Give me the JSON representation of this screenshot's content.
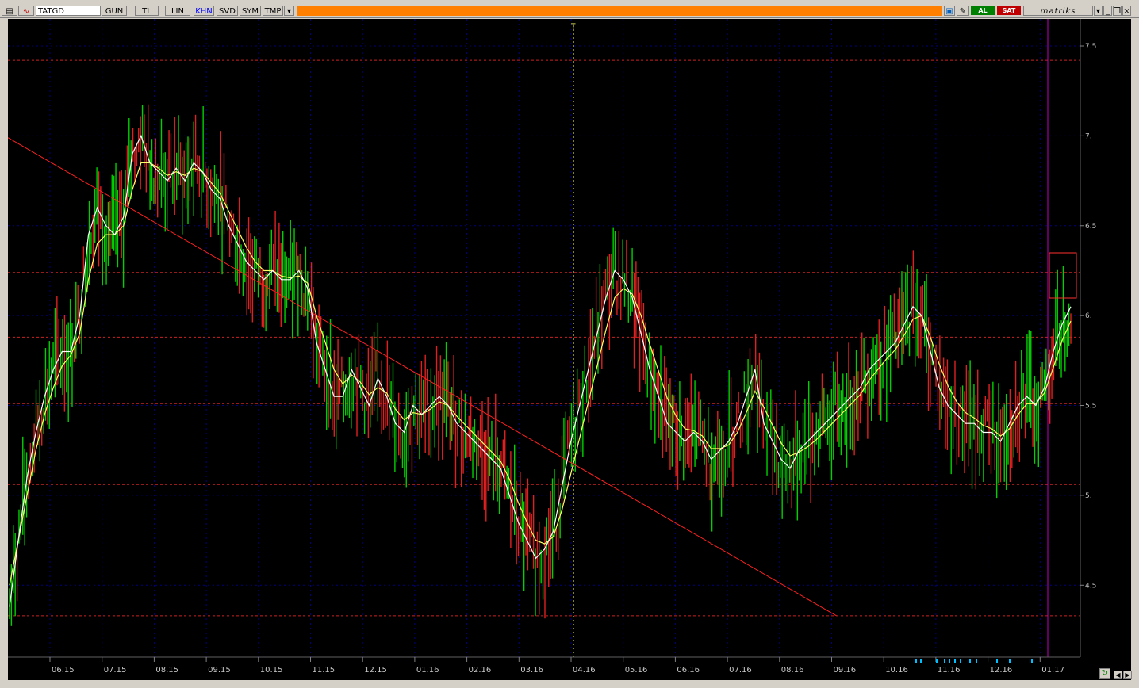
{
  "toolbar": {
    "symbol": "TATGD",
    "buttons": [
      "GUN",
      "TL",
      "LIN",
      "KHN",
      "SVD",
      "SYM",
      "TMP"
    ],
    "active": "KHN",
    "buy_label": "AL",
    "sell_label": "SAT",
    "brand": "matriks"
  },
  "colors": {
    "background": "#000000",
    "grid": "#000080",
    "up_bar": "#00d000",
    "down_bar": "#e02020",
    "ma_fast": "#ffffff",
    "ma_slow": "#ffff66",
    "trendline": "#ff2020",
    "hline": "#cc2020",
    "toolbar_accent": "#ff8000"
  },
  "chart_data": {
    "type": "line",
    "title": "",
    "xlabel": "",
    "ylabel": "",
    "y_tick_labels": [
      "4.5",
      "5.",
      "5.5",
      "6.",
      "6.5",
      "7.",
      "7.5"
    ],
    "ylim": [
      4.1,
      7.65
    ],
    "x_tick_labels": [
      "06.15",
      "07.15",
      "08.15",
      "09.15",
      "10.15",
      "11.15",
      "12.15",
      "01.16",
      "02.16",
      "03.16",
      "04.16",
      "05.16",
      "06.16",
      "07.16",
      "08.16",
      "09.16",
      "10.16",
      "11.16",
      "12.16",
      "01.17"
    ],
    "grid": true,
    "horizontal_levels": [
      7.42,
      6.24,
      5.88,
      5.51,
      5.06,
      4.33
    ],
    "trendline": {
      "from": [
        "06.15",
        6.99
      ],
      "to": [
        "09.16",
        4.33
      ]
    },
    "series": [
      {
        "values": [
          4.38,
          4.75,
          5.1,
          5.35,
          5.55,
          5.7,
          5.8,
          5.8,
          6.0,
          6.45,
          6.6,
          6.5,
          6.45,
          6.55,
          6.9,
          7.0,
          6.85,
          6.8,
          6.75,
          6.82,
          6.75,
          6.85,
          6.8,
          6.7,
          6.65,
          6.5,
          6.4,
          6.3,
          6.25,
          6.2,
          6.25,
          6.2,
          6.2,
          6.25,
          6.15,
          5.85,
          5.7,
          5.55,
          5.55,
          5.7,
          5.6,
          5.5,
          5.65,
          5.55,
          5.4,
          5.35,
          5.5,
          5.45,
          5.5,
          5.55,
          5.5,
          5.4,
          5.35,
          5.3,
          5.25,
          5.2,
          5.15,
          5.0,
          4.85,
          4.75,
          4.65,
          4.7,
          4.8,
          5.05,
          5.3,
          5.5,
          5.7,
          5.9,
          6.1,
          6.25,
          6.2,
          6.1,
          5.9,
          5.7,
          5.55,
          5.4,
          5.35,
          5.3,
          5.35,
          5.3,
          5.2,
          5.25,
          5.3,
          5.4,
          5.55,
          5.7,
          5.4,
          5.3,
          5.2,
          5.15,
          5.25,
          5.3,
          5.35,
          5.4,
          5.45,
          5.5,
          5.55,
          5.6,
          5.7,
          5.75,
          5.8,
          5.85,
          5.95,
          6.05,
          6.0,
          5.8,
          5.6,
          5.5,
          5.45,
          5.4,
          5.4,
          5.35,
          5.35,
          5.3,
          5.4,
          5.5,
          5.55,
          5.5,
          5.6,
          5.8,
          5.95,
          6.05
        ]
      },
      {
        "values": [
          4.5,
          4.75,
          5.0,
          5.25,
          5.45,
          5.6,
          5.72,
          5.78,
          5.9,
          6.2,
          6.4,
          6.45,
          6.45,
          6.5,
          6.7,
          6.85,
          6.85,
          6.82,
          6.78,
          6.8,
          6.78,
          6.82,
          6.8,
          6.74,
          6.68,
          6.58,
          6.48,
          6.38,
          6.3,
          6.25,
          6.25,
          6.22,
          6.21,
          6.22,
          6.18,
          6.0,
          5.85,
          5.7,
          5.62,
          5.67,
          5.63,
          5.56,
          5.6,
          5.57,
          5.48,
          5.42,
          5.46,
          5.45,
          5.48,
          5.52,
          5.5,
          5.44,
          5.39,
          5.34,
          5.29,
          5.24,
          5.19,
          5.09,
          4.96,
          4.85,
          4.75,
          4.73,
          4.77,
          4.92,
          5.12,
          5.32,
          5.52,
          5.72,
          5.92,
          6.1,
          6.15,
          6.12,
          6.0,
          5.84,
          5.69,
          5.54,
          5.44,
          5.37,
          5.36,
          5.33,
          5.26,
          5.26,
          5.28,
          5.35,
          5.46,
          5.58,
          5.49,
          5.39,
          5.29,
          5.22,
          5.24,
          5.27,
          5.31,
          5.36,
          5.41,
          5.46,
          5.51,
          5.56,
          5.64,
          5.7,
          5.76,
          5.81,
          5.89,
          5.98,
          6.0,
          5.88,
          5.73,
          5.61,
          5.52,
          5.46,
          5.43,
          5.39,
          5.37,
          5.33,
          5.37,
          5.45,
          5.51,
          5.51,
          5.57,
          5.71,
          5.86,
          5.97
        ]
      }
    ]
  }
}
